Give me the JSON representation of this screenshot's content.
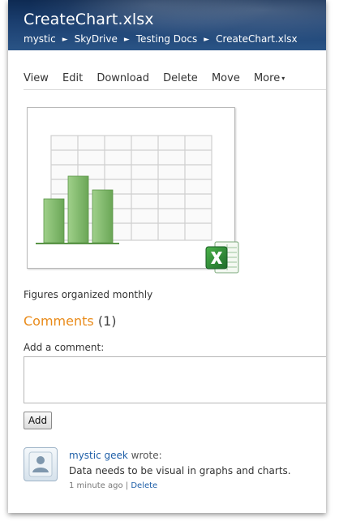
{
  "header": {
    "title": "CreateChart.xlsx",
    "breadcrumb": [
      "mystic",
      "SkyDrive",
      "Testing Docs",
      "CreateChart.xlsx"
    ],
    "breadcrumb_separator": "►"
  },
  "toolbar": {
    "view": "View",
    "edit": "Edit",
    "download": "Download",
    "delete": "Delete",
    "move": "Move",
    "more": "More",
    "more_arrow": "▾"
  },
  "file": {
    "description": "Figures organized monthly",
    "icon": "excel-icon"
  },
  "comments": {
    "heading": "Comments",
    "count": "(1)",
    "add_label": "Add a comment:",
    "add_button": "Add",
    "items": [
      {
        "author": "mystic geek",
        "wrote": "wrote:",
        "text": "Data needs to be visual in graphs and charts.",
        "time": "1 minute ago",
        "separator": "|",
        "delete": "Delete"
      }
    ]
  },
  "colors": {
    "header": "#1b3f70",
    "accent": "#e98b1a",
    "link": "#1f5fa8",
    "chart_bar": "#7db86a"
  }
}
